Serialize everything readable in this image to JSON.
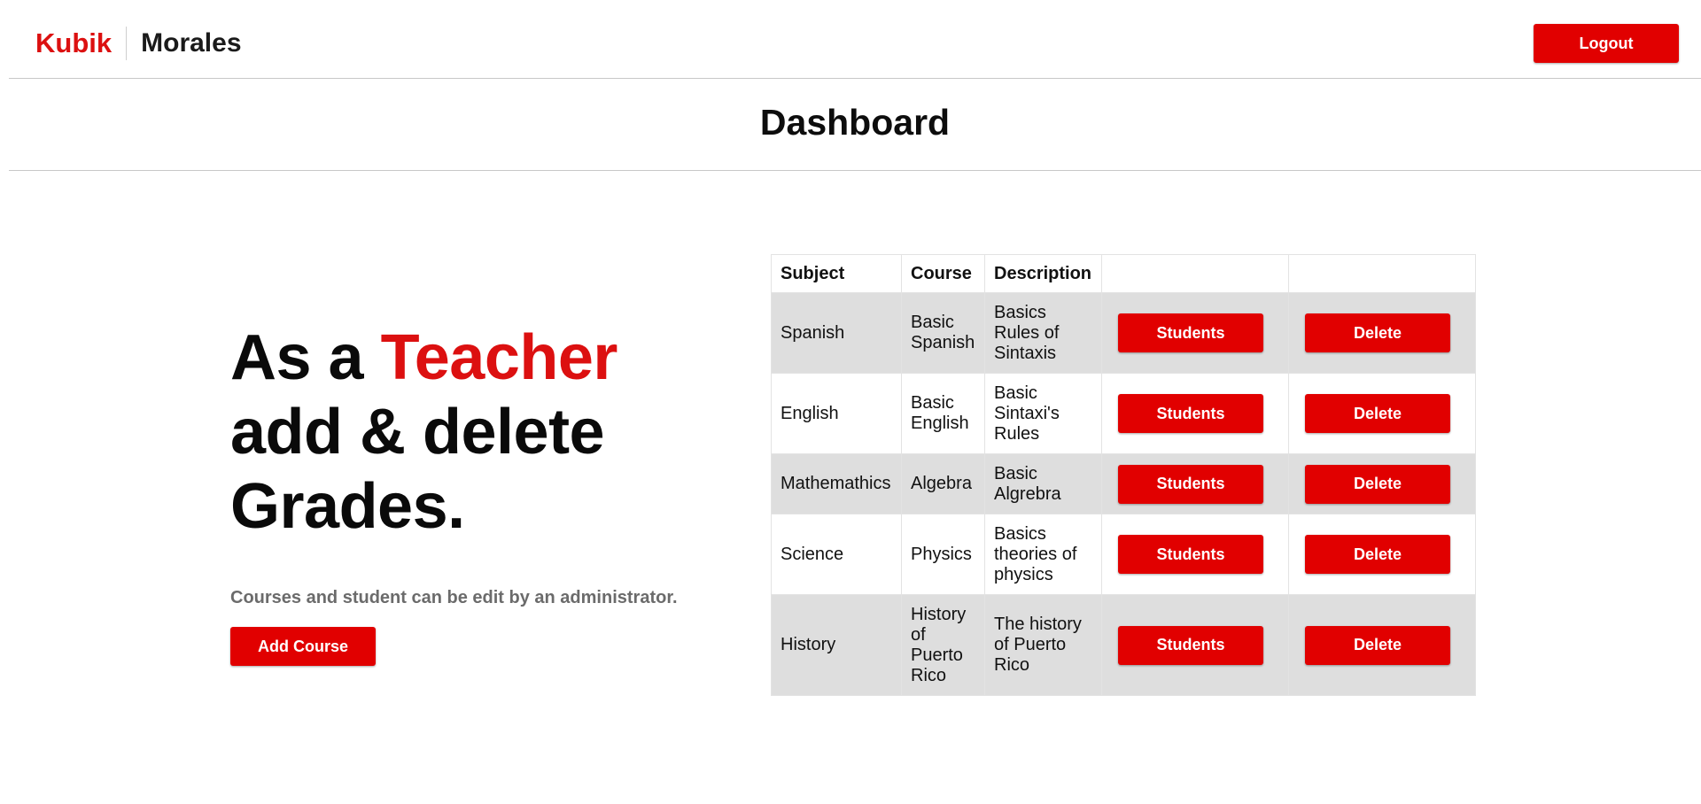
{
  "navbar": {
    "brand": "Kubik",
    "user": "Morales",
    "logout_label": "Logout"
  },
  "page": {
    "title": "Dashboard"
  },
  "hero": {
    "line1_prefix": "As a ",
    "line1_accent": "Teacher",
    "line2": "add & delete",
    "line3": "Grades.",
    "subtitle": "Courses and student can be edit by an administrator.",
    "add_course_label": "Add Course"
  },
  "table": {
    "headers": [
      "Subject",
      "Course",
      "Description",
      "",
      ""
    ],
    "rows": [
      {
        "subject": "Spanish",
        "course": "Basic Spanish",
        "description": "Basics Rules of Sintaxis",
        "students_label": "Students",
        "delete_label": "Delete"
      },
      {
        "subject": "English",
        "course": "Basic English",
        "description": "Basic Sintaxi's Rules",
        "students_label": "Students",
        "delete_label": "Delete"
      },
      {
        "subject": "Mathemathics",
        "course": "Algebra",
        "description": "Basic Algrebra",
        "students_label": "Students",
        "delete_label": "Delete"
      },
      {
        "subject": "Science",
        "course": "Physics",
        "description": "Basics theories of physics",
        "students_label": "Students",
        "delete_label": "Delete"
      },
      {
        "subject": "History",
        "course": "History of Puerto Rico",
        "description": "The history of Puerto Rico",
        "students_label": "Students",
        "delete_label": "Delete"
      }
    ]
  },
  "colors": {
    "accent": "#dc1010",
    "button": "#e10000",
    "row_shade": "#dedede",
    "subtitle": "#6b6b6b"
  }
}
